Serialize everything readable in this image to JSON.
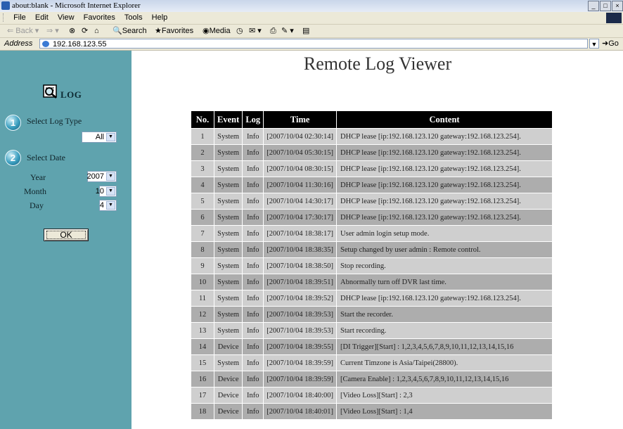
{
  "browser": {
    "title": "about:blank - Microsoft Internet Explorer",
    "menu": [
      "File",
      "Edit",
      "View",
      "Favorites",
      "Tools",
      "Help"
    ],
    "toolbar": {
      "back": "Back",
      "search": "Search",
      "favorites": "Favorites",
      "media": "Media"
    },
    "address_label": "Address",
    "address_value": "192.168.123.55",
    "go_label": "Go"
  },
  "sidebar": {
    "log_label": "LOG",
    "step1_number": "1",
    "step1_label": "Select Log Type",
    "log_type_value": "All",
    "step2_number": "2",
    "step2_label": "Select Date",
    "year_label": "Year",
    "year_value": "2007",
    "month_label": "Month",
    "month_value": "10",
    "day_label": "Day",
    "day_value": "4",
    "ok_label": "OK"
  },
  "main": {
    "title": "Remote Log Viewer",
    "columns": [
      "No.",
      "Event",
      "Log",
      "Time",
      "Content"
    ],
    "rows": [
      [
        "1",
        "System",
        "Info",
        "[2007/10/04 02:30:14]",
        "DHCP lease [ip:192.168.123.120 gateway:192.168.123.254]."
      ],
      [
        "2",
        "System",
        "Info",
        "[2007/10/04 05:30:15]",
        "DHCP lease [ip:192.168.123.120 gateway:192.168.123.254]."
      ],
      [
        "3",
        "System",
        "Info",
        "[2007/10/04 08:30:15]",
        "DHCP lease [ip:192.168.123.120 gateway:192.168.123.254]."
      ],
      [
        "4",
        "System",
        "Info",
        "[2007/10/04 11:30:16]",
        "DHCP lease [ip:192.168.123.120 gateway:192.168.123.254]."
      ],
      [
        "5",
        "System",
        "Info",
        "[2007/10/04 14:30:17]",
        "DHCP lease [ip:192.168.123.120 gateway:192.168.123.254]."
      ],
      [
        "6",
        "System",
        "Info",
        "[2007/10/04 17:30:17]",
        "DHCP lease [ip:192.168.123.120 gateway:192.168.123.254]."
      ],
      [
        "7",
        "System",
        "Info",
        "[2007/10/04 18:38:17]",
        "User admin login setup mode."
      ],
      [
        "8",
        "System",
        "Info",
        "[2007/10/04 18:38:35]",
        "Setup changed by user admin : Remote control."
      ],
      [
        "9",
        "System",
        "Info",
        "[2007/10/04 18:38:50]",
        "Stop recording."
      ],
      [
        "10",
        "System",
        "Info",
        "[2007/10/04 18:39:51]",
        "Abnormally turn off DVR last time."
      ],
      [
        "11",
        "System",
        "Info",
        "[2007/10/04 18:39:52]",
        "DHCP lease [ip:192.168.123.120 gateway:192.168.123.254]."
      ],
      [
        "12",
        "System",
        "Info",
        "[2007/10/04 18:39:53]",
        "Start the recorder."
      ],
      [
        "13",
        "System",
        "Info",
        "[2007/10/04 18:39:53]",
        "Start recording."
      ],
      [
        "14",
        "Device",
        "Info",
        "[2007/10/04 18:39:55]",
        "[DI Trigger][Start] : 1,2,3,4,5,6,7,8,9,10,11,12,13,14,15,16"
      ],
      [
        "15",
        "System",
        "Info",
        "[2007/10/04 18:39:59]",
        "Current Timzone is Asia/Taipei(28800)."
      ],
      [
        "16",
        "Device",
        "Info",
        "[2007/10/04 18:39:59]",
        "[Camera Enable] : 1,2,3,4,5,6,7,8,9,10,11,12,13,14,15,16"
      ],
      [
        "17",
        "Device",
        "Info",
        "[2007/10/04 18:40:00]",
        "[Video Loss][Start] : 2,3"
      ],
      [
        "18",
        "Device",
        "Info",
        "[2007/10/04 18:40:01]",
        "[Video Loss][Start] : 1,4"
      ]
    ]
  }
}
